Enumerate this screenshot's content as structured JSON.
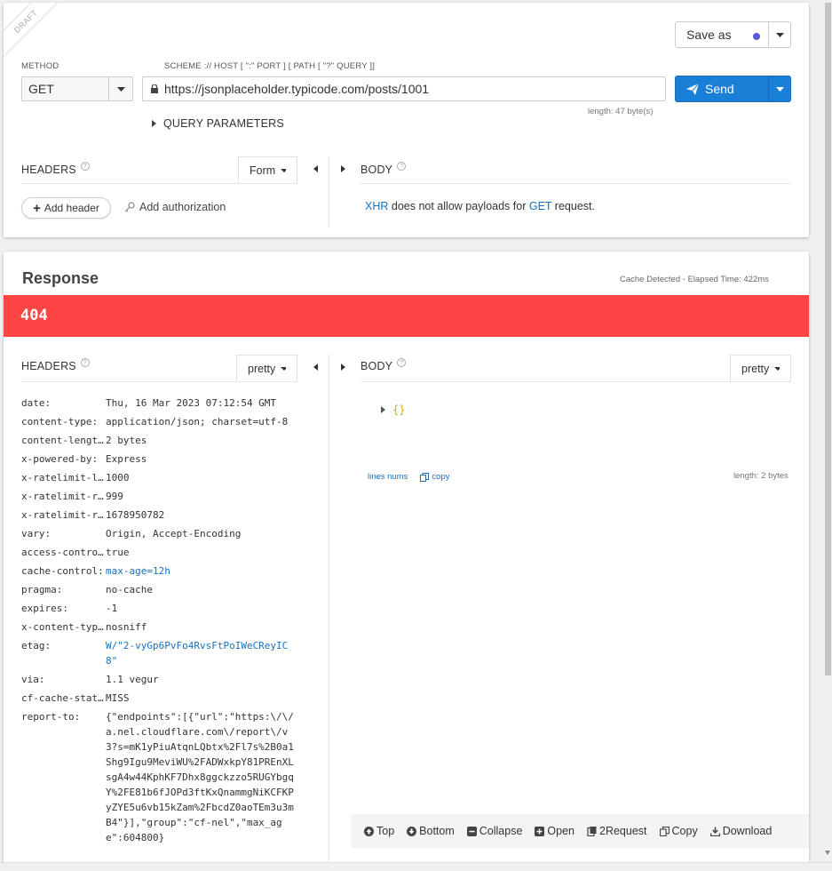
{
  "request": {
    "ribbon": "DRAFT",
    "save_as_label": "Save as",
    "method_label": "METHOD",
    "method_value": "GET",
    "url_label": "SCHEME :// HOST [ \":\" PORT ] [ PATH [ \"?\" QUERY ]]",
    "url_value": "https://jsonplaceholder.typicode.com/posts/1001",
    "url_length": "length: 47 byte(s)",
    "send_label": "Send",
    "query_params_label": "QUERY PARAMETERS",
    "headers_title": "HEADERS",
    "headers_mode": "Form",
    "body_title": "BODY",
    "add_header_label": "Add header",
    "add_authorization_label": "Add authorization",
    "xhr_message": {
      "xhr": "XHR",
      "part1": " does not allow payloads for ",
      "get": "GET",
      "part2": " request."
    }
  },
  "response": {
    "title": "Response",
    "cache_info": "Cache Detected - Elapsed Time: 422ms",
    "status_code": "404",
    "status_color": "#ff4444",
    "headers_title": "HEADERS",
    "headers_mode": "pretty",
    "body_title": "BODY",
    "body_mode": "pretty",
    "headers": [
      {
        "key": "date:",
        "value": "Thu, 16 Mar 2023 07:12:54 GMT"
      },
      {
        "key": "content-type:",
        "value": "application/json; charset=utf-8"
      },
      {
        "key": "content-length:",
        "value": "2 bytes"
      },
      {
        "key": "x-powered-by:",
        "value": "Express"
      },
      {
        "key": "x-ratelimit-limit:",
        "value": "1000"
      },
      {
        "key": "x-ratelimit-remaining:",
        "value": "999"
      },
      {
        "key": "x-ratelimit-reset:",
        "value": "1678950782"
      },
      {
        "key": "vary:",
        "value": "Origin, Accept-Encoding"
      },
      {
        "key": "access-control-allow-credentials:",
        "value": "true"
      },
      {
        "key": "cache-control:",
        "value": "max-age=12h",
        "link": true
      },
      {
        "key": "pragma:",
        "value": "no-cache"
      },
      {
        "key": "expires:",
        "value": "-1"
      },
      {
        "key": "x-content-type-options:",
        "value": "nosniff"
      },
      {
        "key": "etag:",
        "value": "W/\"2-vyGp6PvFo4RvsFtPoIWeCReyIC8\"",
        "link": true
      },
      {
        "key": "via:",
        "value": "1.1 vegur"
      },
      {
        "key": "cf-cache-status:",
        "value": "MISS"
      },
      {
        "key": "report-to:",
        "value": "{\"endpoints\":[{\"url\":\"https:\\/\\/a.nel.cloudflare.com\\/report\\/v3?s=mK1yPiuAtqnLQbtx%2Fl7s%2B0a1Shg9Igu9MeviWU%2FADWxkpY81PREnXLsgA4w44KphKF7Dhx8ggckzzo5RUGYbgqY%2FE81b6fJOPd3ftKxQnammgNiKCFKPyZYE5u6vb15kZam%2FbcdZ0aoTEm3u3mB4\"}],\"group\":\"cf-nel\",\"max_age\":604800}"
      }
    ],
    "body_json": "{}",
    "lines_nums_label": "lines nums",
    "copy_label": "copy",
    "body_length": "length: 2 bytes",
    "toolbar": {
      "top": "Top",
      "bottom": "Bottom",
      "collapse": "Collapse",
      "open": "Open",
      "to_request": "2Request",
      "copy": "Copy",
      "download": "Download"
    }
  },
  "colors": {
    "accent": "#1a7fd6",
    "link": "#1a6fbd",
    "json_brace": "#e8a317"
  }
}
